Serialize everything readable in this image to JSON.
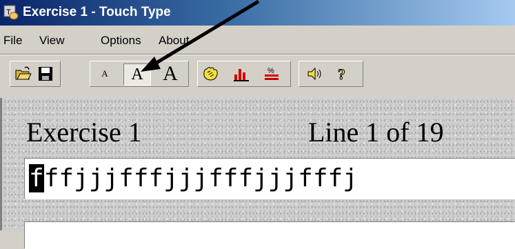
{
  "window": {
    "title": "Exercise 1 - Touch Type"
  },
  "menu": {
    "items": [
      "File",
      "View",
      "Options",
      "About"
    ]
  },
  "toolbar": {
    "font_small": "A",
    "font_medium": "A",
    "font_large": "A",
    "selected_font_size": "medium",
    "icons": [
      "open-folder-icon",
      "save-icon",
      "hands-icon",
      "chart-icon",
      "percent-icon",
      "speaker-icon",
      "help-icon"
    ]
  },
  "exercise": {
    "label": "Exercise 1",
    "line_label": "Line 1 of 19",
    "current_char": "f",
    "remaining_text": "ffjjjfffjjjfffjjjfffj"
  },
  "colors": {
    "title_start": "#0a246a",
    "title_end": "#a6caf0",
    "face": "#d4d0c8"
  }
}
